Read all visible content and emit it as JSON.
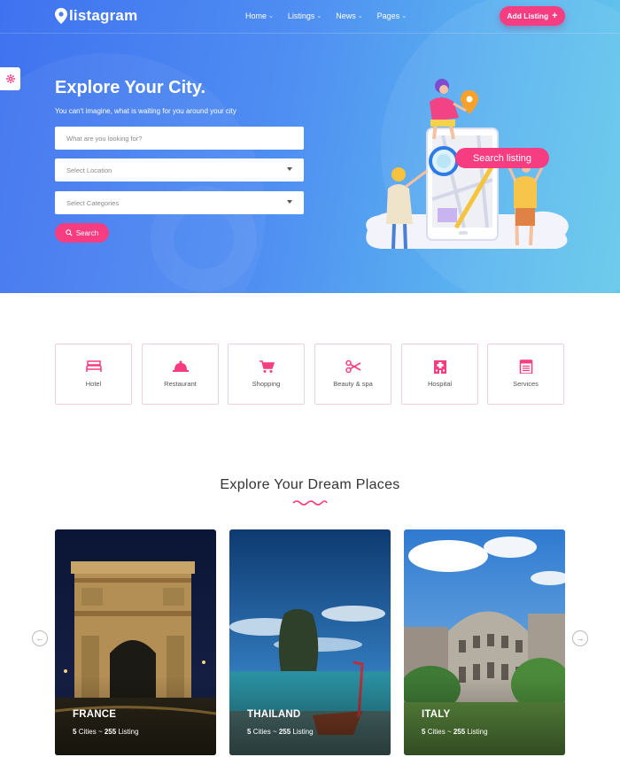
{
  "header": {
    "logo_text": "listagram",
    "menu": [
      {
        "label": "Home"
      },
      {
        "label": "Listings"
      },
      {
        "label": "News"
      },
      {
        "label": "Pages"
      }
    ],
    "add_listing_label": "Add Listing",
    "add_listing_icon": "plus-icon"
  },
  "hero": {
    "title": "Explore Your City.",
    "subtitle": "You can't imagine, what is waiting for you around your city",
    "search_placeholder": "What are you looking for?",
    "location_placeholder": "Select Location",
    "category_placeholder": "Select Categories",
    "search_button": "Search",
    "illustration_pill": "Search listing"
  },
  "categories": [
    {
      "label": "Hotel",
      "icon": "bed-icon"
    },
    {
      "label": "Restaurant",
      "icon": "cloche-icon"
    },
    {
      "label": "Shopping",
      "icon": "cart-icon"
    },
    {
      "label": "Beauty & spa",
      "icon": "scissors-icon"
    },
    {
      "label": "Hospital",
      "icon": "hospital-icon"
    },
    {
      "label": "Services",
      "icon": "clipboard-icon"
    }
  ],
  "places": {
    "title": "Explore Your Dream Places",
    "cards": [
      {
        "name": "FRANCE",
        "cities": "5",
        "cities_label": "Cities",
        "sep": "~",
        "listings": "255",
        "listings_label": "Listing"
      },
      {
        "name": "THAILAND",
        "cities": "5",
        "cities_label": "Cities",
        "sep": "~",
        "listings": "255",
        "listings_label": "Listing"
      },
      {
        "name": "ITALY",
        "cities": "5",
        "cities_label": "Cities",
        "sep": "~",
        "listings": "255",
        "listings_label": "Listing"
      }
    ]
  },
  "colors": {
    "accent": "#f63d81",
    "hero_start": "#3f72f0",
    "hero_end": "#63c8ea"
  }
}
